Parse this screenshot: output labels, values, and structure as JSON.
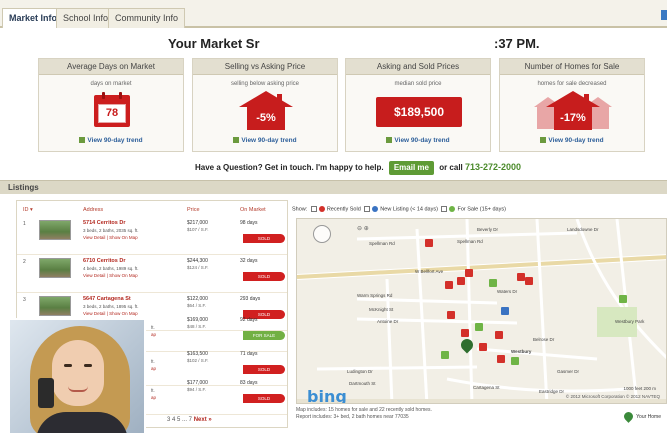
{
  "tabs": [
    {
      "label": "Market Info",
      "active": true
    },
    {
      "label": "School Info",
      "active": false
    },
    {
      "label": "Community Info",
      "active": false
    }
  ],
  "headline": {
    "left": "Your Market Sr",
    "right": ":37 PM."
  },
  "cards": [
    {
      "title": "Average Days on Market",
      "subtitle": "days on market",
      "value": "78",
      "trend": "View 90-day trend"
    },
    {
      "title": "Selling vs Asking Price",
      "subtitle": "selling below asking price",
      "value": "-5%",
      "trend": "View 90-day trend"
    },
    {
      "title": "Asking and Sold Prices",
      "subtitle": "median sold price",
      "value": "$189,500",
      "trend": "View 90-day trend"
    },
    {
      "title": "Number of Homes for Sale",
      "subtitle": "homes for sale decreased",
      "value": "-17%",
      "trend": "View 90-day trend"
    }
  ],
  "contact": {
    "question": "Have a Question? Get in touch. I'm happy to help.",
    "email_button": "Email me",
    "or_call": "or call",
    "phone": "713-272-2000"
  },
  "listings": {
    "title": "Listings",
    "columns": {
      "id": "ID ▾",
      "address": "Address",
      "price": "Price",
      "market": "On Market"
    },
    "rows": [
      {
        "num": "1",
        "address": "5714 Cerritos Dr",
        "details": "3 beds, 2 baths, 2035 sq. ft.",
        "links": "View Detail | Show On Map",
        "price": "$217,000",
        "ppsf": "$107 / S.F.",
        "days": "98 days",
        "status": "SOLD",
        "kind": "sold"
      },
      {
        "num": "2",
        "address": "6710 Cerritos Dr",
        "details": "4 beds, 2 baths, 1989 sq. ft.",
        "links": "View Detail | Show On Map",
        "price": "$244,300",
        "ppsf": "$124 / S.F.",
        "days": "32 days",
        "status": "SOLD",
        "kind": "sold"
      },
      {
        "num": "3",
        "address": "5647 Cartagena St",
        "details": "3 beds, 2 baths, 1895 sq. ft.",
        "links": "View Detail | Show On Map",
        "price": "$122,000",
        "ppsf": "$64 / S.F.",
        "days": "293 days",
        "status": "SOLD",
        "kind": "sold"
      },
      {
        "num": "",
        "address": "",
        "details": "ft.",
        "links": "ap",
        "price": "$169,000",
        "ppsf": "$48 / S.F.",
        "days": "92 days",
        "status": "FOR SALE",
        "kind": "sale"
      },
      {
        "num": "",
        "address": "",
        "details": "ft.",
        "links": "ap",
        "price": "$163,500",
        "ppsf": "$102 / S.F.",
        "days": "71 days",
        "status": "SOLD",
        "kind": "sold"
      },
      {
        "num": "",
        "address": "",
        "details": "ft.",
        "links": "ap",
        "price": "$177,000",
        "ppsf": "$94 / S.F.",
        "days": "83 days",
        "status": "SOLD",
        "kind": "sold"
      }
    ],
    "pager": "3  4  5 ... 7",
    "pager_next": "Next »"
  },
  "map": {
    "show_label": "Show:",
    "filters": [
      {
        "label": "Recently Sold",
        "color": "#d3302a"
      },
      {
        "label": "New Listing (< 14 days)",
        "color": "#3a73c2"
      },
      {
        "label": "For Sale (15+ days)",
        "color": "#6fb446"
      }
    ],
    "provider": "bing",
    "copyright": "© 2012 Microsoft Corporation   © 2012 NAVTEQ",
    "scale": "1000 feet        200 m",
    "note_line1": "Map includes: 15 homes for sale and 22 recently sold homes.",
    "note_line2": "Report includes: 3+ bed, 2 bath homes near 77035",
    "your_home": "Your Home",
    "streets": [
      "W Bellfort Ave",
      "Spellman Rd",
      "Beverly Dr",
      "Landsdowne Dr",
      "Spellman Rd",
      "Waters Dr",
      "Warm Springs Rd",
      "McKnight St",
      "Antoine Dr",
      "Belrose Dr",
      "Ludington Dr",
      "Dartmouth St",
      "Westbury",
      "Gasmer Dr",
      "Westbury Park",
      "Eastridge Dr",
      "Cartagena St"
    ]
  }
}
